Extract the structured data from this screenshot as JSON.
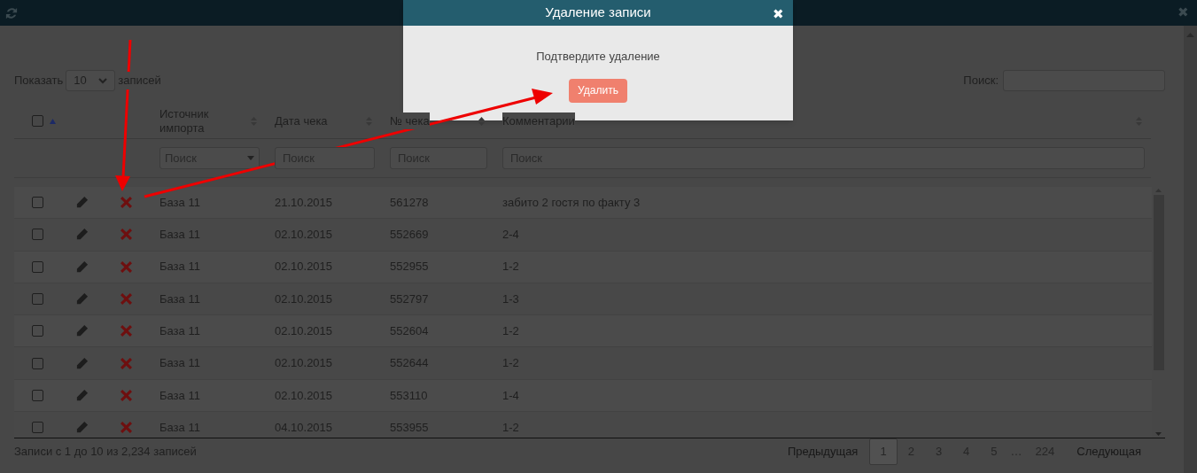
{
  "modal": {
    "title": "Удаление записи",
    "close": "✖",
    "message": "Подтвердите удаление",
    "confirm_button": "Удалить"
  },
  "window": {
    "close": "✖"
  },
  "length": {
    "label_before": "Показать",
    "value": "10",
    "label_after": "записей"
  },
  "search": {
    "label": "Поиск:"
  },
  "table": {
    "select_all": {
      "checked": false
    },
    "columns": [
      {
        "label": "Источник импорта"
      },
      {
        "label": "Дата чека"
      },
      {
        "label": "№ чека"
      },
      {
        "label": "Комментарии"
      }
    ],
    "filters": [
      {
        "kind": "select",
        "placeholder": "Поиск"
      },
      {
        "kind": "text",
        "placeholder": "Поиск"
      },
      {
        "kind": "text",
        "placeholder": "Поиск"
      },
      {
        "kind": "text",
        "placeholder": "Поиск"
      }
    ],
    "rows": [
      {
        "checked": false,
        "cells": [
          "База 11",
          "21.10.2015",
          "561278",
          "забито 2 гостя по факту 3"
        ]
      },
      {
        "checked": false,
        "cells": [
          "База 11",
          "02.10.2015",
          "552669",
          "2-4"
        ]
      },
      {
        "checked": false,
        "cells": [
          "База 11",
          "02.10.2015",
          "552955",
          "1-2"
        ]
      },
      {
        "checked": false,
        "cells": [
          "База 11",
          "02.10.2015",
          "552797",
          "1-3"
        ]
      },
      {
        "checked": false,
        "cells": [
          "База 11",
          "02.10.2015",
          "552604",
          "1-2"
        ]
      },
      {
        "checked": false,
        "cells": [
          "База 11",
          "02.10.2015",
          "552644",
          "1-2"
        ]
      },
      {
        "checked": false,
        "cells": [
          "База 11",
          "02.10.2015",
          "553110",
          "1-4"
        ]
      },
      {
        "checked": false,
        "cells": [
          "База 11",
          "04.10.2015",
          "553955",
          "1-2"
        ]
      }
    ]
  },
  "footer": {
    "info": "Записи с 1 до 10 из 2,234 записей",
    "pagination": [
      {
        "kind": "link",
        "label": "Предыдущая",
        "selected": false
      },
      {
        "kind": "page",
        "label": "1",
        "selected": true
      },
      {
        "kind": "page",
        "label": "2",
        "selected": false
      },
      {
        "kind": "page",
        "label": "3",
        "selected": false
      },
      {
        "kind": "page",
        "label": "4",
        "selected": false
      },
      {
        "kind": "page",
        "label": "5",
        "selected": false
      },
      {
        "kind": "ellipsis",
        "label": "…",
        "selected": false
      },
      {
        "kind": "page",
        "label": "224",
        "selected": false
      },
      {
        "kind": "link",
        "label": "Следующая",
        "selected": false
      }
    ]
  }
}
